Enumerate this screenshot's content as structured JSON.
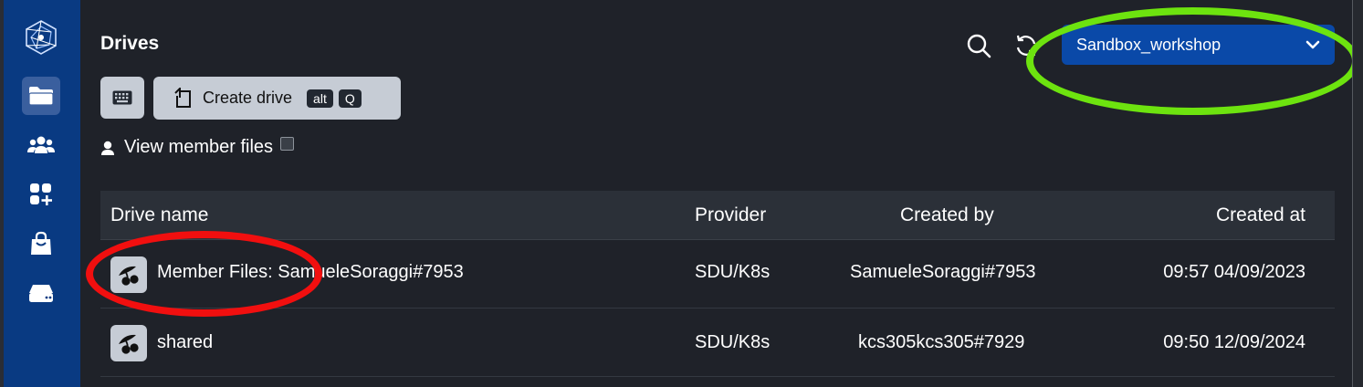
{
  "page": {
    "title": "Drives"
  },
  "sidebar": {
    "items": [
      {
        "icon": "logo-icon"
      },
      {
        "icon": "files-icon",
        "active": true
      },
      {
        "icon": "users-icon"
      },
      {
        "icon": "apps-icon"
      },
      {
        "icon": "shop-icon"
      },
      {
        "icon": "drive-icon"
      }
    ]
  },
  "header": {
    "project_selector": "Sandbox_workshop"
  },
  "toolbar": {
    "create_label": "Create drive",
    "shortcut_alt": "alt",
    "shortcut_key": "Q"
  },
  "filter": {
    "view_member_files_label": "View member files",
    "view_member_files_checked": false
  },
  "table": {
    "headers": {
      "name": "Drive name",
      "provider": "Provider",
      "created_by": "Created by",
      "created_at": "Created at"
    },
    "rows": [
      {
        "name": "Member Files: SamueleSoraggi#7953",
        "provider": "SDU/K8s",
        "created_by": "SamueleSoraggi#7953",
        "created_at": "09:57 04/09/2023"
      },
      {
        "name": "shared",
        "provider": "SDU/K8s",
        "created_by": "kcs305kcs305#7929",
        "created_at": "09:50 12/09/2024"
      }
    ]
  },
  "annotations": {
    "green_ellipse_color": "#6de30f",
    "red_ellipse_color": "#f10f0f"
  }
}
